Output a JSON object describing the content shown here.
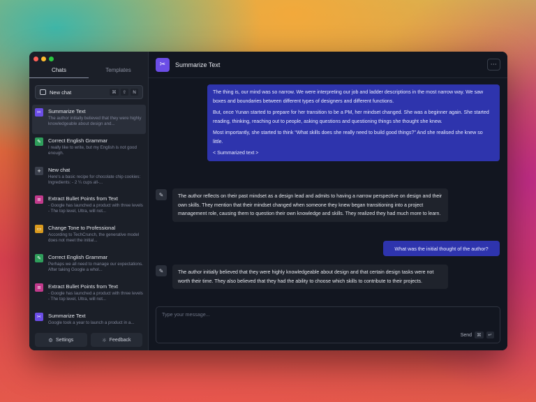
{
  "sidebar": {
    "tabs": [
      {
        "label": "Chats",
        "active": true
      },
      {
        "label": "Templates",
        "active": false
      }
    ],
    "new_chat": {
      "label": "New chat",
      "shortcut_keys": [
        "⌘",
        "⇧",
        "N"
      ]
    },
    "chats": [
      {
        "title": "Summarize Text",
        "preview": "The author initially believed that they were highly knowledgeable about design and...",
        "icon": "scissors-icon",
        "icon_color": "#6b4de6",
        "selected": true
      },
      {
        "title": "Correct English Grammar",
        "preview": "I really like to write, but my English is not good enough.",
        "icon": "pencil-icon",
        "icon_color": "#2f9e5b",
        "selected": false
      },
      {
        "title": "New chat",
        "preview": "Here's a basic recipe for chocolate chip cookies: Ingredients: - 2 ¼ cups all-...",
        "icon": "plus-icon",
        "icon_color": "#3a3f4b",
        "selected": false
      },
      {
        "title": "Extract Bullet Points from Text",
        "preview": "- Google has launched a product with three levels - The top level, Ultra, will not...",
        "icon": "list-icon",
        "icon_color": "#c23a8c",
        "selected": false
      },
      {
        "title": "Change Tone to Professional",
        "preview": "According to TechCrunch, the generative model does not meet the initial...",
        "icon": "briefcase-icon",
        "icon_color": "#d99a1e",
        "selected": false
      },
      {
        "title": "Correct English Grammar",
        "preview": "Perhaps we all need to manage our expectations. After taking Google a whol...",
        "icon": "pencil-icon",
        "icon_color": "#2f9e5b",
        "selected": false
      },
      {
        "title": "Extract Bullet Points from Text",
        "preview": "- Google has launched a product with three levels - The top level, Ultra, will not...",
        "icon": "list-icon",
        "icon_color": "#c23a8c",
        "selected": false
      },
      {
        "title": "Summarize Text",
        "preview": "Google took a year to launch a product in a...",
        "icon": "scissors-icon",
        "icon_color": "#6b4de6",
        "selected": false
      }
    ],
    "footer": {
      "settings_label": "Settings",
      "feedback_label": "Feedback"
    }
  },
  "main": {
    "header": {
      "title": "Summarize Text",
      "icon": "scissors-icon",
      "icon_color": "#6b4de6",
      "more_label": "···"
    },
    "messages": {
      "user_1": [
        "The thing is, our mind was so narrow. We were interpreting our job and ladder descriptions in the most narrow way. We saw boxes and boundaries between different types of designers and different functions.",
        "But, once Yunan started to prepare for her transition to be a PM, her mindset changed. She was a beginner again. She started reading, thinking, reaching out to people, asking questions and questioning things she thought she knew.",
        "Most importantly, she started to think “What skills does she really need to build good things?” And she realised she knew so little.",
        "< Summarized text >"
      ],
      "bot_1": "The author reflects on their past mindset as a design lead and admits to having a narrow perspective on design and their own skills. They mention that their mindset changed when someone they knew began transitioning into a project management role, causing them to question their own knowledge and skills. They realized they had much more to learn.",
      "user_2": "What was the initial thought of the author?",
      "bot_2": "The author initially believed that they were highly knowledgeable about design and that certain design tasks were not worth their time. They also believed that they had the ability to choose which skills to contribute to their projects."
    },
    "composer": {
      "placeholder": "Type your message...",
      "send_label": "Send",
      "send_keys": [
        "⌘",
        "↵"
      ]
    }
  },
  "colors": {
    "accent": "#2e34ad",
    "window_bg": "#121620",
    "sidebar_bg": "#1b1f28"
  }
}
